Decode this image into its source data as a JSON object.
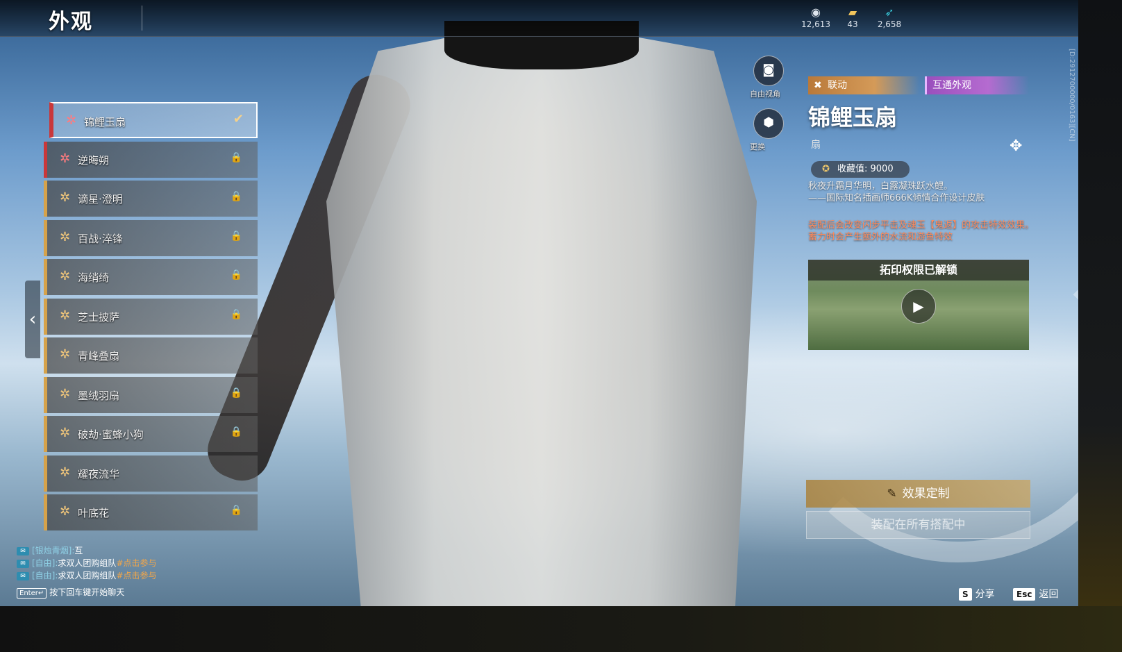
{
  "header": {
    "title": "外观",
    "currencies": [
      {
        "icon": "jade-icon",
        "value": "12,613"
      },
      {
        "icon": "ticket-icon",
        "value": "43"
      },
      {
        "icon": "feather-icon",
        "value": "2,658"
      }
    ],
    "build_id": "[D:2912700000/0163][CN]"
  },
  "list": {
    "items": [
      {
        "label": "锦鲤玉扇",
        "rarity": "red",
        "selected": true,
        "locked": false
      },
      {
        "label": "逆晦朔",
        "rarity": "red",
        "selected": false,
        "locked": true
      },
      {
        "label": "谪星·澄明",
        "rarity": "gold",
        "selected": false,
        "locked": true
      },
      {
        "label": "百战·淬锋",
        "rarity": "gold",
        "selected": false,
        "locked": true
      },
      {
        "label": "海绡绮",
        "rarity": "gold",
        "selected": false,
        "locked": true
      },
      {
        "label": "芝士披萨",
        "rarity": "gold",
        "selected": false,
        "locked": true
      },
      {
        "label": "青峰叠扇",
        "rarity": "gold",
        "selected": false,
        "locked": false
      },
      {
        "label": "墨绒羽扇",
        "rarity": "gold",
        "selected": false,
        "locked": true
      },
      {
        "label": "破劫·蜜蜂小狗",
        "rarity": "gold",
        "selected": false,
        "locked": true
      },
      {
        "label": "耀夜流华",
        "rarity": "gold",
        "selected": false,
        "locked": false
      },
      {
        "label": "叶底花",
        "rarity": "gold",
        "selected": false,
        "locked": true
      }
    ],
    "check_icon": "✔",
    "lock_icon": "🔒"
  },
  "camera": {
    "free_view_label": "自由视角",
    "change_label": "更换"
  },
  "detail": {
    "tag_collab": "联动",
    "tag_shared": "互通外观",
    "title": "锦鲤玉扇",
    "type": "扇",
    "collect_label": "收藏值: 9000",
    "desc_line1": "秋夜升霜月华明，白露凝珠跃水鲤。",
    "desc_line2": "——国际知名插画师666K倾情合作设计皮肤",
    "effect_line1": "装配后会改变闪步平击及魂玉【鬼返】的攻击特效效果。",
    "effect_line2": "蓄力时会产生额外的水流和游鱼特效",
    "preview_title": "拓印权限已解锁",
    "btn_customize": "效果定制",
    "btn_equip": "装配在所有搭配中"
  },
  "chat": {
    "lines": [
      {
        "channel": "[银烛青烟]:",
        "text": "互",
        "tag": ""
      },
      {
        "channel": "[自由]:",
        "text": "求双人团购组队",
        "tag": "#点击参与"
      },
      {
        "channel": "[自由]:",
        "text": "求双人团购组队",
        "tag": "#点击参与"
      }
    ],
    "enter_key": "Enter↵",
    "enter_hint": "按下回车键开始聊天"
  },
  "footer": {
    "share_key": "S",
    "share_label": "分享",
    "back_key": "Esc",
    "back_label": "返回"
  },
  "colors": {
    "rarity_red": "#c9373a",
    "rarity_gold": "#d6a24a",
    "effect_text": "#ff8a5b"
  }
}
